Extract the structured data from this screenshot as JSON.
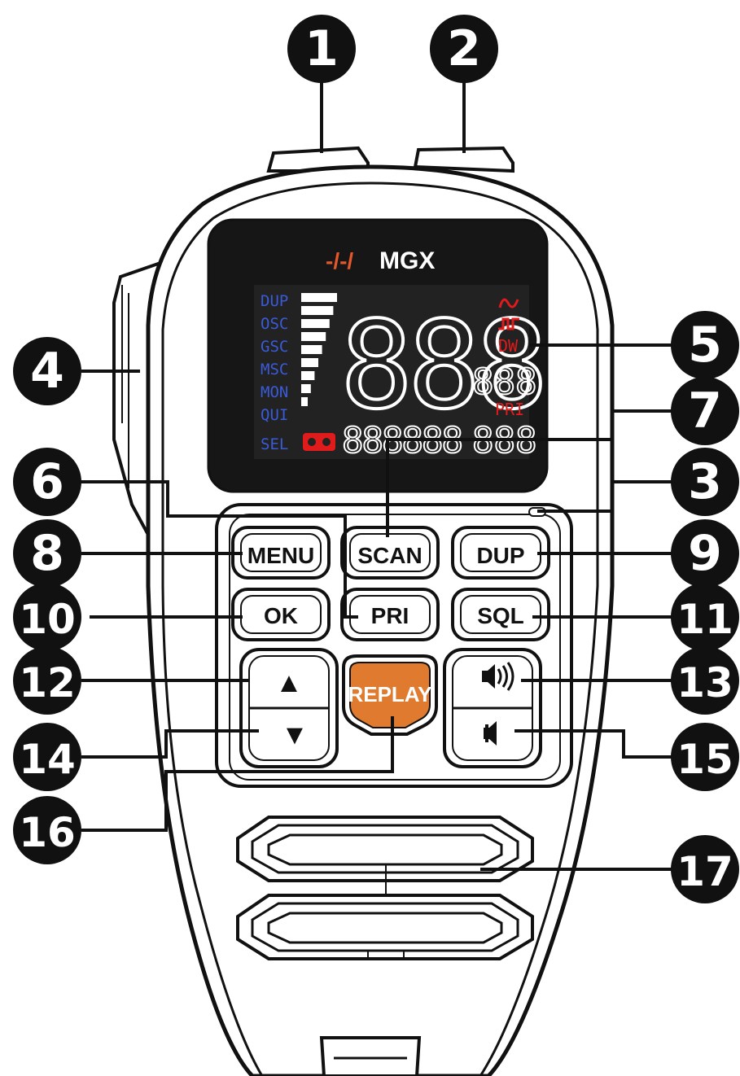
{
  "brand": {
    "logo_mark": "-/-/",
    "name": "MGX"
  },
  "display": {
    "modes": [
      "DUP",
      "OSC",
      "GSC",
      "MSC",
      "MON",
      "QUI",
      "SEL"
    ],
    "main_digits": "888",
    "small_right_digits": "888",
    "bottom_left_digits": "888888",
    "bottom_right_digits": "888",
    "dw_label": "DW",
    "pri_label": "PRI",
    "signal_bars": 9,
    "icons": [
      "wave-icon",
      "pulse-icon",
      "tape-icon"
    ],
    "colors": {
      "mode_text": "#3a5bd8",
      "status_text": "#e01b1b",
      "segments": "#ffffff",
      "screen": "#111111"
    }
  },
  "buttons": {
    "menu": "MENU",
    "scan": "SCAN",
    "dup": "DUP",
    "ok": "OK",
    "pri": "PRI",
    "sql": "SQL",
    "replay": "REPLAY",
    "up": "▲",
    "down": "▼",
    "replay_color": "#e07a2e"
  },
  "callouts": [
    "1",
    "2",
    "3",
    "4",
    "5",
    "6",
    "7",
    "8",
    "9",
    "10",
    "11",
    "12",
    "13",
    "14",
    "15",
    "16",
    "17"
  ]
}
